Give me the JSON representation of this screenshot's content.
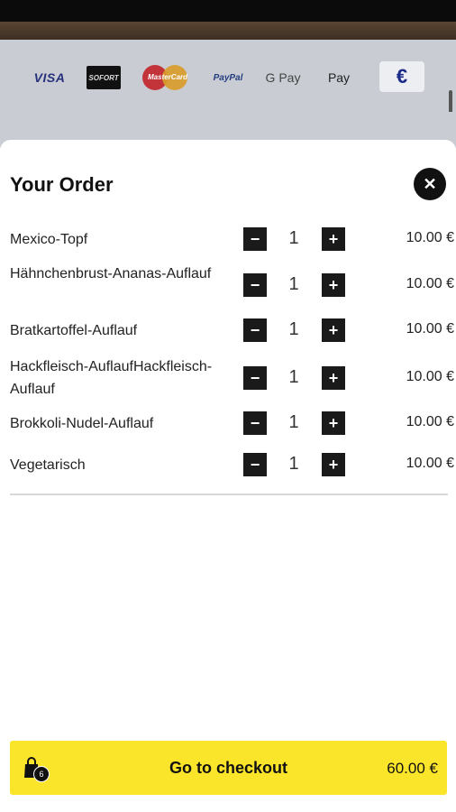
{
  "payment_methods": {
    "visa": "VISA",
    "sofort": "SOFORT",
    "mastercard": "MasterCard",
    "paypal": "PayPal",
    "gpay": "G Pay",
    "applepay": " Pay",
    "currency": "€"
  },
  "modal": {
    "title": "Your Order",
    "close_icon": "close-icon"
  },
  "order": {
    "items": [
      {
        "name": "Mexico-Topf",
        "qty": "1",
        "price": "10.00 €"
      },
      {
        "name": "Hähnchenbrust-Ananas-Auflauf",
        "qty": "1",
        "price": "10.00 €"
      },
      {
        "name": "Bratkartoffel-Auflauf",
        "qty": "1",
        "price": "10.00 €"
      },
      {
        "name": "Hackfleisch-AuflaufHackfleisch-Auflauf",
        "qty": "1",
        "price": "10.00 €"
      },
      {
        "name": "Brokkoli-Nudel-Auflauf",
        "qty": "1",
        "price": "10.00 €"
      },
      {
        "name": "Vegetarisch",
        "qty": "1",
        "price": "10.00 €"
      }
    ],
    "minus_label": "−",
    "plus_label": "+"
  },
  "checkout": {
    "label": "Go to checkout",
    "total": "60.00 €",
    "cart_count": "6"
  },
  "colors": {
    "accent": "#fbe52a",
    "dark": "#111111"
  }
}
